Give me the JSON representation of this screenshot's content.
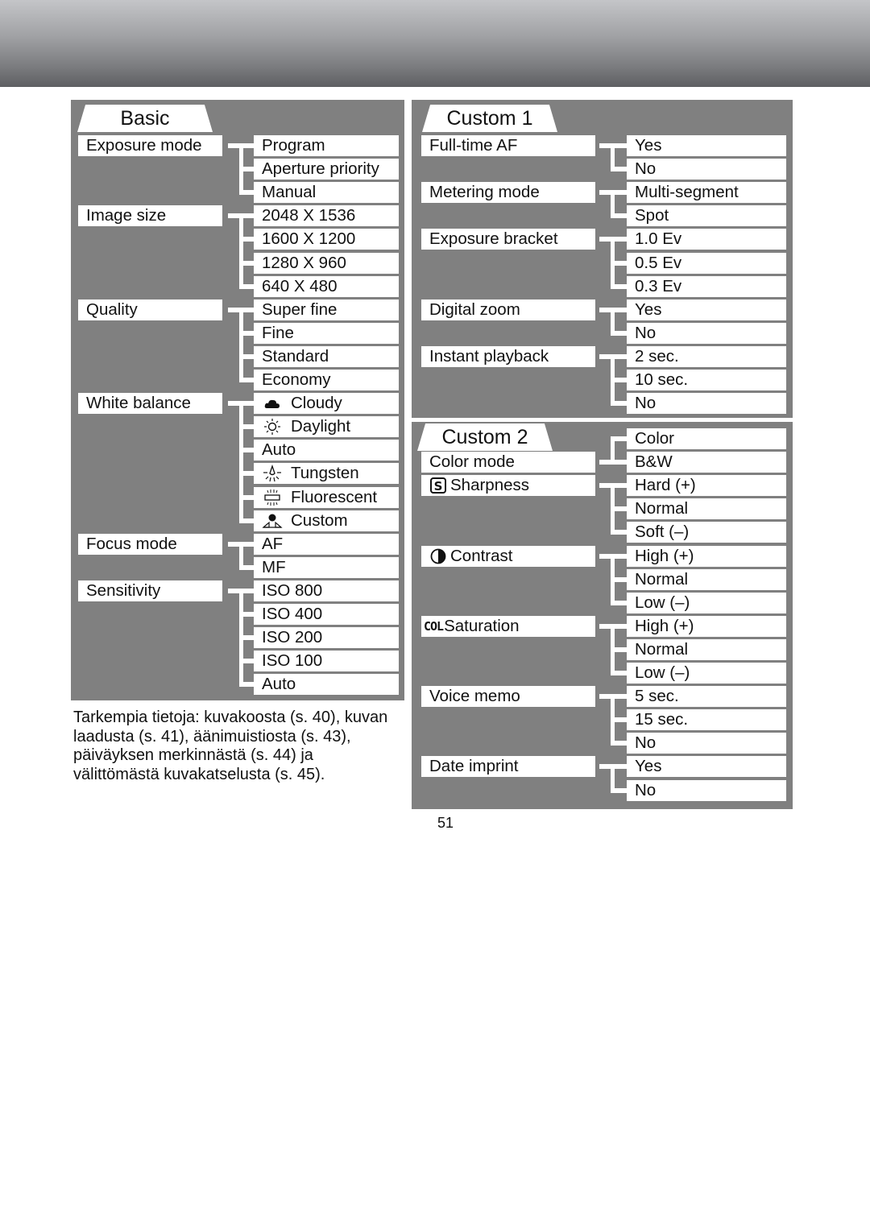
{
  "page": {
    "number": "51",
    "note": "Tarkempia tietoja: kuvakoosta (s. 40), kuvan laadusta (s. 41), äänimuistiosta (s. 43), päiväyksen merkinnästä (s. 44) ja välittömästä kuvakatselusta (s. 45)."
  },
  "panels": {
    "basic": {
      "title": "Basic",
      "groups": [
        {
          "label": "Exposure mode",
          "options": [
            {
              "text": "Program"
            },
            {
              "text": "Aperture priority"
            },
            {
              "text": "Manual"
            }
          ]
        },
        {
          "label": "Image size",
          "options": [
            {
              "text": "2048 X 1536"
            },
            {
              "text": "1600 X 1200"
            },
            {
              "text": "1280 X 960"
            },
            {
              "text": "640 X 480"
            }
          ]
        },
        {
          "label": "Quality",
          "options": [
            {
              "text": "Super fine"
            },
            {
              "text": "Fine"
            },
            {
              "text": "Standard"
            },
            {
              "text": "Economy"
            }
          ]
        },
        {
          "label": "White balance",
          "options": [
            {
              "text": "Cloudy",
              "icon": "cloudy-icon"
            },
            {
              "text": "Daylight",
              "icon": "daylight-icon"
            },
            {
              "text": "Auto"
            },
            {
              "text": "Tungsten",
              "icon": "tungsten-icon"
            },
            {
              "text": "Fluorescent",
              "icon": "fluorescent-icon"
            },
            {
              "text": "Custom",
              "icon": "custom-wb-icon"
            }
          ]
        },
        {
          "label": "Focus mode",
          "options": [
            {
              "text": "AF"
            },
            {
              "text": "MF"
            }
          ]
        },
        {
          "label": "Sensitivity",
          "options": [
            {
              "text": "ISO 800"
            },
            {
              "text": "ISO 400"
            },
            {
              "text": "ISO 200"
            },
            {
              "text": "ISO 100"
            },
            {
              "text": "Auto"
            }
          ]
        }
      ]
    },
    "custom1": {
      "title": "Custom 1",
      "groups": [
        {
          "label": "Full-time AF",
          "options": [
            {
              "text": "Yes"
            },
            {
              "text": "No"
            }
          ]
        },
        {
          "label": "Metering mode",
          "options": [
            {
              "text": "Multi-segment"
            },
            {
              "text": "Spot"
            }
          ]
        },
        {
          "label": "Exposure bracket",
          "options": [
            {
              "text": "1.0 Ev"
            },
            {
              "text": "0.5 Ev"
            },
            {
              "text": "0.3 Ev"
            }
          ]
        },
        {
          "label": "Digital zoom",
          "options": [
            {
              "text": "Yes"
            },
            {
              "text": "No"
            }
          ]
        },
        {
          "label": "Instant playback",
          "options": [
            {
              "text": "2 sec."
            },
            {
              "text": "10 sec."
            },
            {
              "text": "No"
            }
          ]
        }
      ]
    },
    "custom2": {
      "title": "Custom 2",
      "groups": [
        {
          "label": "Color mode",
          "label_offset": 1,
          "options": [
            {
              "text": "Color"
            },
            {
              "text": "B&W"
            }
          ]
        },
        {
          "label": "Sharpness",
          "icon": "sharpness-icon",
          "options": [
            {
              "text": "Hard (+)"
            },
            {
              "text": "Normal"
            },
            {
              "text": "Soft (–)"
            }
          ]
        },
        {
          "label": "Contrast",
          "icon": "contrast-icon",
          "options": [
            {
              "text": "High (+)"
            },
            {
              "text": "Normal"
            },
            {
              "text": "Low (–)"
            }
          ]
        },
        {
          "label": "Saturation",
          "icon": "saturation-icon",
          "icon_text": "COL",
          "options": [
            {
              "text": "High (+)"
            },
            {
              "text": "Normal"
            },
            {
              "text": "Low (–)"
            }
          ]
        },
        {
          "label": "Voice memo",
          "options": [
            {
              "text": "5 sec."
            },
            {
              "text": "15 sec."
            },
            {
              "text": "No"
            }
          ]
        },
        {
          "label": "Date imprint",
          "options": [
            {
              "text": "Yes"
            },
            {
              "text": "No"
            }
          ]
        }
      ]
    }
  }
}
